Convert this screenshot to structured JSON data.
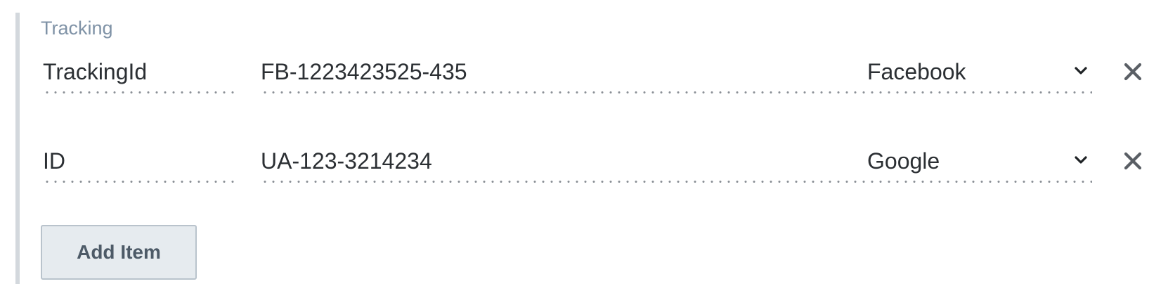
{
  "section": {
    "title": "Tracking"
  },
  "rows": [
    {
      "key": "TrackingId",
      "value": "FB-1223423525-435",
      "provider": "Facebook"
    },
    {
      "key": "ID",
      "value": "UA-123-3214234",
      "provider": "Google"
    }
  ],
  "icons": {
    "dropdown": "chevron-down-icon",
    "remove": "close-icon"
  },
  "add_button_label": "Add Item",
  "colors": {
    "title": "#7f92a6",
    "text": "#2b2f33",
    "button_bg": "#e6ebef",
    "button_border": "#b9c3cc",
    "button_text": "#4d5a67",
    "icon": "#5a5f65"
  }
}
